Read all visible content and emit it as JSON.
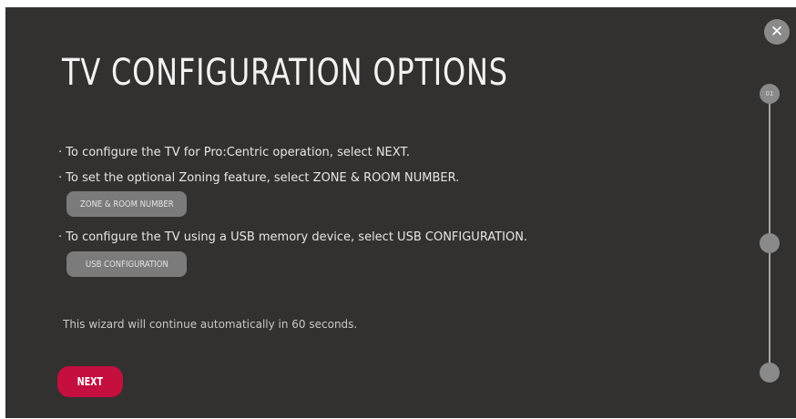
{
  "screen": {
    "title": "TV CONFIGURATION OPTIONS",
    "instructions": [
      "· To configure the TV for Pro:Centric operation, select NEXT.",
      "· To set the optional Zoning feature, select ZONE & ROOM NUMBER.",
      "· To configure the TV using a USB memory device, select USB CONFIGURATION."
    ],
    "zone_button_label": "ZONE & ROOM NUMBER",
    "usb_button_label": "USB CONFIGURATION",
    "wizard_note": "This wizard will continue automatically in 60 seconds.",
    "next_button_label": "NEXT",
    "close_icon": "close-icon"
  },
  "progress": {
    "steps": [
      "01",
      "",
      ""
    ],
    "current_step": 1
  },
  "colors": {
    "background": "#333130",
    "accent": "#c40f3f",
    "button": "#7b7b7b",
    "text": "#e6e6e6"
  }
}
